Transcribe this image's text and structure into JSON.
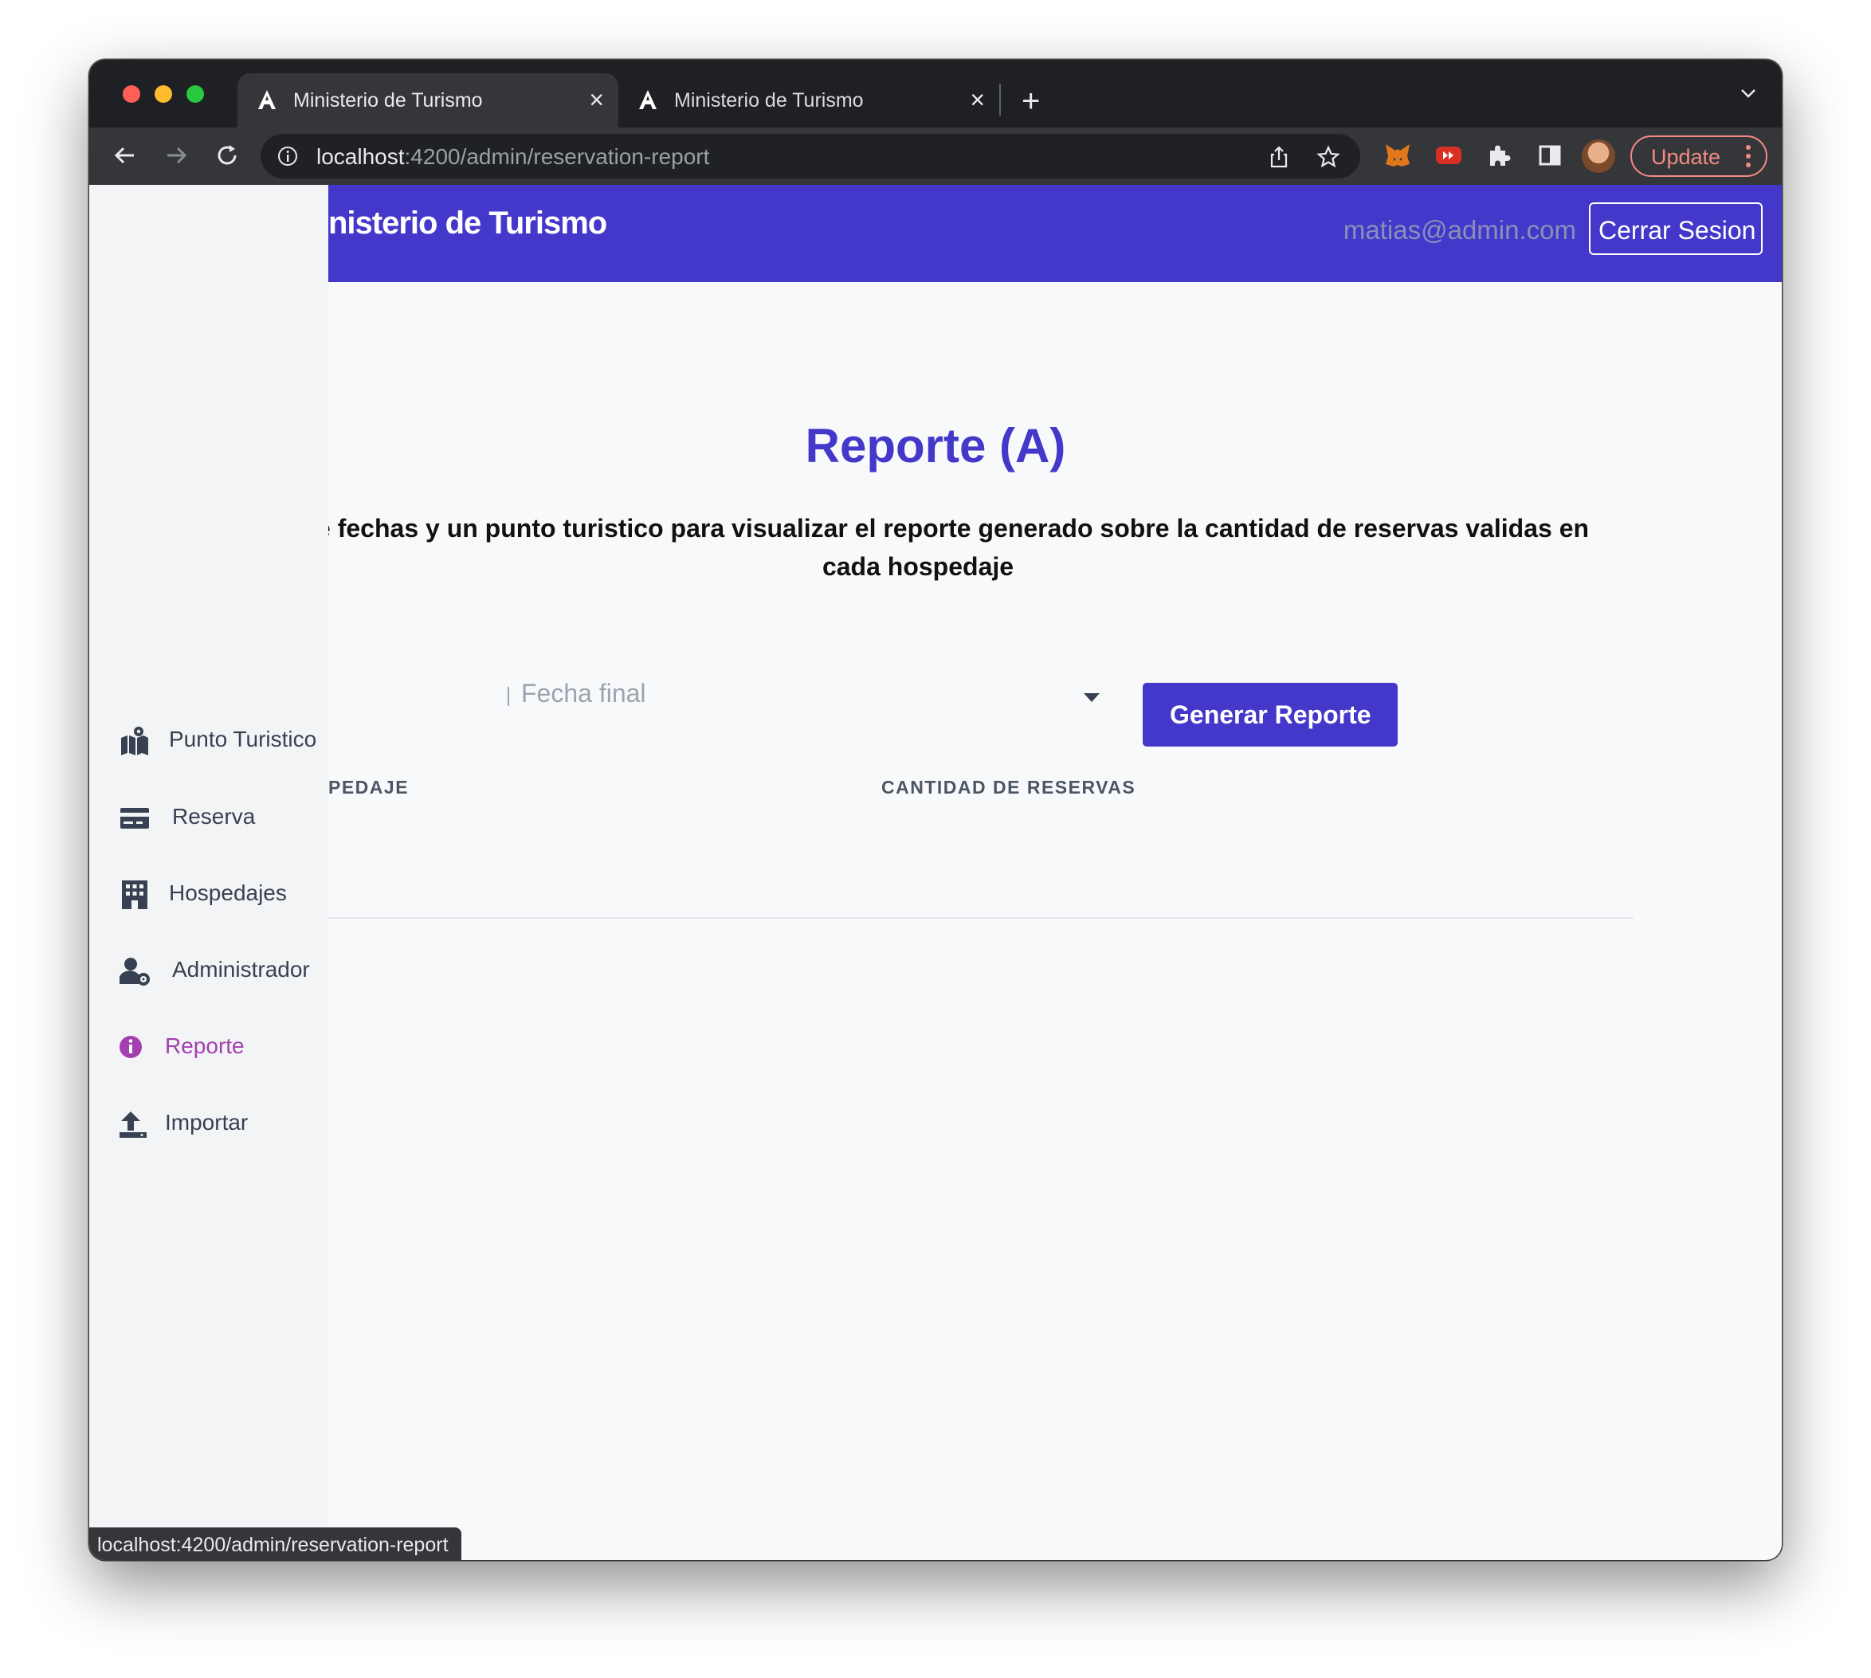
{
  "browser": {
    "tabs": [
      {
        "title": "Ministerio de Turismo",
        "active": true
      },
      {
        "title": "Ministerio de Turismo",
        "active": false
      }
    ],
    "url_host": "localhost",
    "url_path": ":4200/admin/reservation-report",
    "update_label": "Update",
    "status_url": "localhost:4200/admin/reservation-report",
    "colors": {
      "traffic_red": "#ff5f57",
      "traffic_yellow": "#febc2e",
      "traffic_green": "#28c840"
    }
  },
  "header": {
    "brand": "nisterio de Turismo",
    "email": "matias@admin.com",
    "logout_label": "Cerrar Sesion",
    "color": "#4338ca"
  },
  "sidebar": {
    "items": [
      {
        "label": "Punto Turistico",
        "icon": "map-marked-icon"
      },
      {
        "label": "Reserva",
        "icon": "credit-card-icon"
      },
      {
        "label": "Hospedajes",
        "icon": "building-icon"
      },
      {
        "label": "Administrador",
        "icon": "user-cog-icon"
      },
      {
        "label": "Reporte",
        "icon": "info-circle-icon",
        "active": true
      },
      {
        "label": "Importar",
        "icon": "upload-icon"
      }
    ]
  },
  "main": {
    "title": "Reporte (A)",
    "description_line1": "ngo de fechas y un punto turistico para visualizar el reporte generado sobre la cantidad de reservas validas en",
    "description_line2": "cada hospedaje",
    "date_end_placeholder": "Fecha final",
    "generate_label": "Generar Reporte",
    "table_headers": [
      "PEDAJE",
      "CANTIDAD DE RESERVAS"
    ]
  }
}
